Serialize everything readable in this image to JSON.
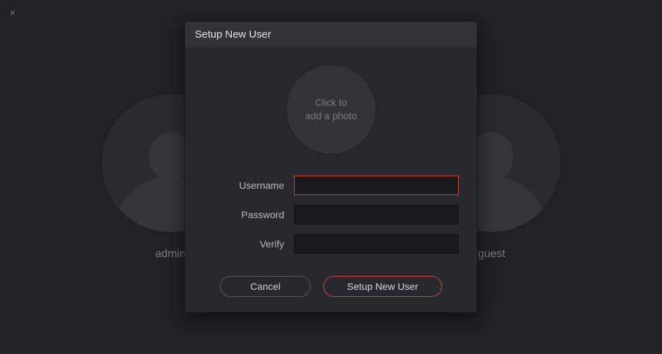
{
  "close_icon": "×",
  "background_users": [
    {
      "label": "admin"
    },
    {
      "label": "guest"
    }
  ],
  "dialog": {
    "title": "Setup New User",
    "photo_prompt": "Click to\nadd a photo",
    "fields": {
      "username": {
        "label": "Username",
        "value": ""
      },
      "password": {
        "label": "Password",
        "value": ""
      },
      "verify": {
        "label": "Verify",
        "value": ""
      }
    },
    "buttons": {
      "cancel": "Cancel",
      "submit": "Setup New User"
    }
  }
}
